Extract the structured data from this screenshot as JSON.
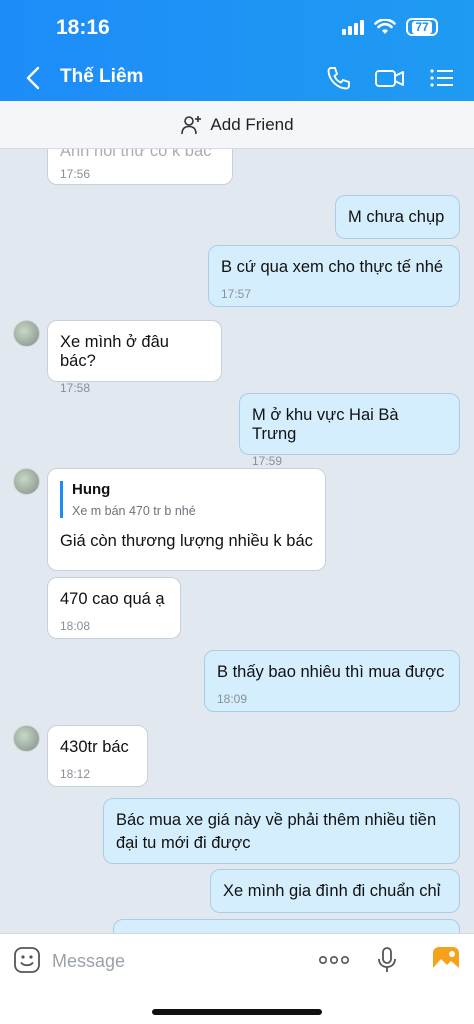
{
  "status": {
    "time": "18:16",
    "battery": "77"
  },
  "header": {
    "contact_name": "Thế Liêm"
  },
  "add_friend": {
    "label": "Add Friend"
  },
  "messages": [
    {
      "text": "Anh hỏi thử có k bác",
      "time": "17:56"
    },
    {
      "text": "M chưa chụp"
    },
    {
      "text": "B cứ qua xem cho thực tế nhé",
      "time": "17:57"
    },
    {
      "text": "Xe mình ở đâu bác?",
      "time": "17:58"
    },
    {
      "text": "M ở khu vực Hai Bà Trưng",
      "time": "17:59"
    },
    {
      "quote_name": "Hung",
      "quote_text": "Xe m bán 470 tr b nhé",
      "text": "Giá còn thương lượng nhiều k bác"
    },
    {
      "text": "470 cao quá ạ",
      "time": "18:08"
    },
    {
      "text": "B thấy bao nhiêu thì mua được",
      "time": "18:09"
    },
    {
      "text": "430tr bác",
      "time": "18:12"
    },
    {
      "text": "Bác mua xe giá này về phải thêm nhiều tiền đại tu mới đi được"
    },
    {
      "text": "Xe mình gia đình đi chuẩn chỉ"
    }
  ],
  "composer": {
    "placeholder": "Message"
  },
  "colors": {
    "header": "#1d8cf8",
    "outgoing_bubble": "#d5eefe",
    "incoming_bubble": "#ffffff",
    "chat_bg": "#e2e8ef"
  }
}
